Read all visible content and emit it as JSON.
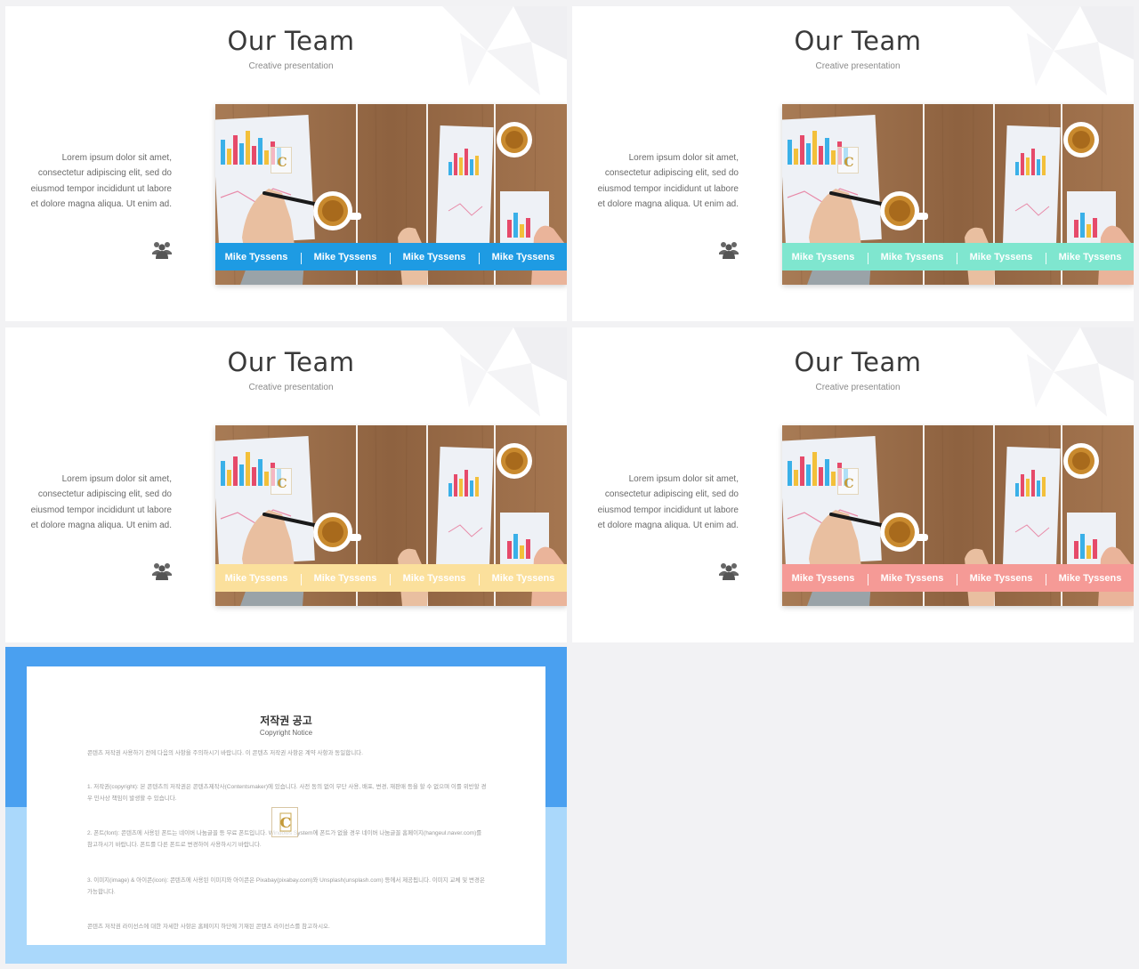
{
  "slides": [
    {
      "title": "Our Team",
      "subtitle": "Creative presentation",
      "body": "Lorem ipsum dolor sit amet, consectetur adipiscing elit, sed do eiusmod tempor incididunt ut labore et dolore magna aliqua. Ut enim ad.",
      "bar_color": "#1e9be3",
      "names": [
        "Mike Tyssens",
        "Mike Tyssens",
        "Mike Tyssens",
        "Mike Tyssens"
      ]
    },
    {
      "title": "Our Team",
      "subtitle": "Creative presentation",
      "body": "Lorem ipsum dolor sit amet, consectetur adipiscing elit, sed do eiusmod tempor incididunt ut labore et dolore magna aliqua. Ut enim ad.",
      "bar_color": "#7fe6cf",
      "names": [
        "Mike Tyssens",
        "Mike Tyssens",
        "Mike Tyssens",
        "Mike Tyssens"
      ]
    },
    {
      "title": "Our Team",
      "subtitle": "Creative presentation",
      "body": "Lorem ipsum dolor sit amet, consectetur adipiscing elit, sed do eiusmod tempor incididunt ut labore et dolore magna aliqua. Ut enim ad.",
      "bar_color": "#fbe09c",
      "names": [
        "Mike Tyssens",
        "Mike Tyssens",
        "Mike Tyssens",
        "Mike Tyssens"
      ]
    },
    {
      "title": "Our Team",
      "subtitle": "Creative presentation",
      "body": "Lorem ipsum dolor sit amet, consectetur adipiscing elit, sed do eiusmod tempor incididunt ut labore et dolore magna aliqua. Ut enim ad.",
      "bar_color": "#f59a96",
      "names": [
        "Mike Tyssens",
        "Mike Tyssens",
        "Mike Tyssens",
        "Mike Tyssens"
      ]
    }
  ],
  "notice": {
    "title": "저작권 공고",
    "subtitle": "Copyright Notice",
    "paragraphs": [
      "콘텐츠 저작권 사용하기 전에 다음의 사항을 주의하시기 바랍니다. 이 콘텐츠 저작권 사항은 계약 사항과 동일합니다.",
      "1. 저작권(copyright): 본 콘텐츠의 저작권은 콘텐츠제작사(Contentsmaker)에 있습니다. 사전 동의 없이 무단 사용, 배포, 변경, 재판매 등을 할 수 없으며 이를 위반할 경우 민사상 책임이 발생할 수 있습니다.",
      "2. 폰트(font): 콘텐츠에 사용된 폰트는 네이버 나눔글꼴 등 무료 폰트입니다. Windows System에 폰트가 없을 경우 네이버 나눔글꼴 홈페이지(hangeul.naver.com)를 참고하시기 바랍니다. 폰트를 다른 폰트로 변경하여 사용하시기 바랍니다.",
      "3. 이미지(image) & 아이콘(icon): 콘텐츠에 사용된 이미지와 아이콘은 Pixabay(pixabay.com)와 Unsplash(unsplash.com) 등에서 제공됩니다. 이미지 교체 및 변경은 가능합니다.",
      "콘텐츠 저작권 라이선스에 대한 자세한 사항은 홈페이지 하단에 기재된 콘텐츠 라이선스를 참고하시오."
    ]
  },
  "icons": {
    "team": "users-icon",
    "logo": "c-logo-icon"
  },
  "colors": {
    "page_bg": "#f2f2f4",
    "notice_top": "#4aa0f0",
    "notice_bottom": "#aad8fb"
  }
}
